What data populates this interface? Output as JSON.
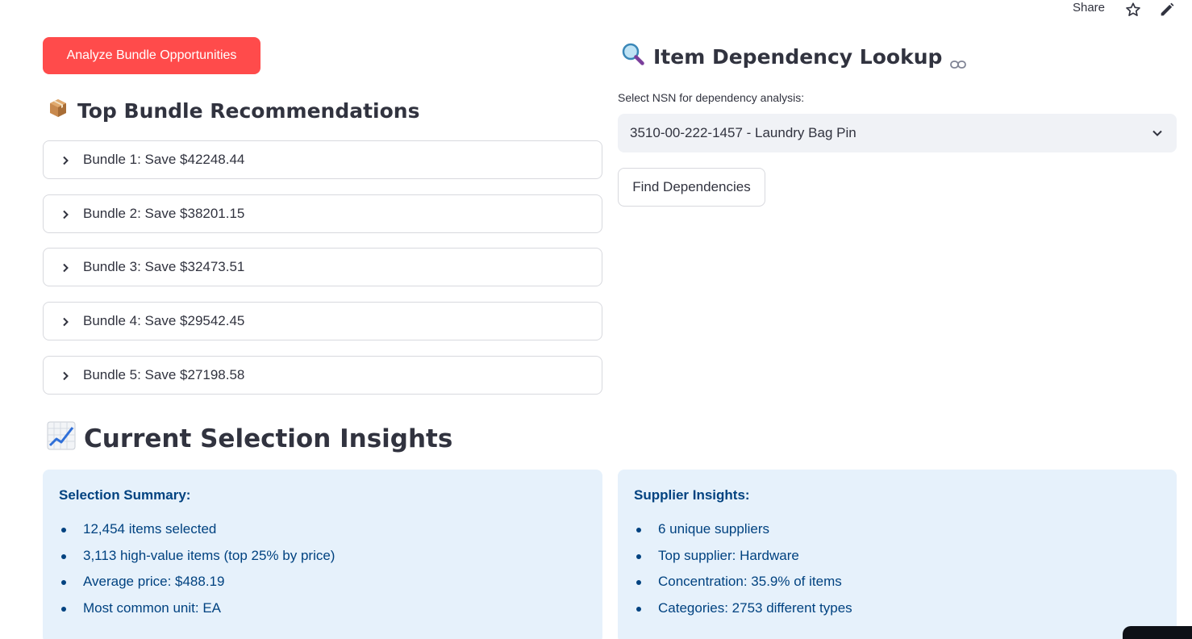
{
  "toolbar": {
    "share_label": "Share",
    "star_icon": "star-icon",
    "edit_icon": "pencil-icon"
  },
  "left": {
    "analyze_button": "Analyze Bundle Opportunities",
    "bundles_title": "Top Bundle Recommendations",
    "bundles_emoji": "package-emoji",
    "bundles": [
      {
        "label": "Bundle 1: Save $42248.44"
      },
      {
        "label": "Bundle 2: Save $38201.15"
      },
      {
        "label": "Bundle 3: Save $32473.51"
      },
      {
        "label": "Bundle 4: Save $29542.45"
      },
      {
        "label": "Bundle 5: Save $27198.58"
      }
    ]
  },
  "right": {
    "lookup_title": "Item Dependency Lookup",
    "lookup_emoji": "magnifier-emoji",
    "select_label": "Select NSN for dependency analysis:",
    "select_value": "3510-00-222-1457 - Laundry Bag Pin",
    "find_button": "Find Dependencies"
  },
  "insights": {
    "title": "Current Selection Insights",
    "emoji": "chart-increasing-emoji",
    "selection": {
      "heading": "Selection Summary:",
      "items": [
        "12,454 items selected",
        "3,113 high-value items (top 25% by price)",
        "Average price: $488.19",
        "Most common unit: EA"
      ]
    },
    "supplier": {
      "heading": "Supplier Insights:",
      "items": [
        "6 unique suppliers",
        "Top supplier: Hardware",
        "Concentration: 35.9% of items",
        "Categories: 2753 different types"
      ]
    }
  },
  "colors": {
    "primary": "#ff4b4b",
    "info_bg": "#e6f1fb",
    "info_text": "#004280",
    "text": "#31333f",
    "border": "#d8d9de",
    "select_bg": "#f0f2f6"
  }
}
